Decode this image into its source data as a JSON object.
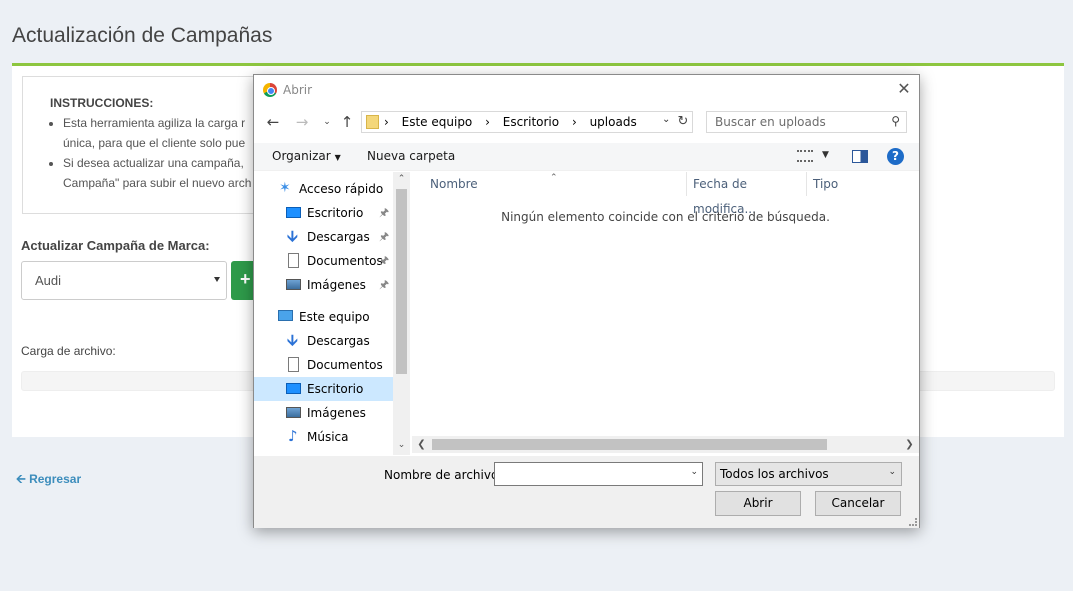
{
  "page": {
    "title": "Actualización de Campañas",
    "instructions": {
      "heading": "INSTRUCCIONES:",
      "items": [
        "Esta herramienta agiliza la carga r",
        "única, para que el cliente solo pue",
        "Si desea actualizar una campaña,",
        "Campaña\" para subir el nuevo arch"
      ]
    },
    "brand_label": "Actualizar Campaña de Marca:",
    "brand_selected": "Audi",
    "add_button": "+",
    "upload_label": "Carga de archivo:",
    "back_link": "Regresar",
    "colors": {
      "accent": "#8dc63f",
      "add_button": "#2e9a4a",
      "link": "#3c8dbc"
    }
  },
  "dialog": {
    "title": "Abrir",
    "close_icon": "close-icon",
    "breadcrumbs": [
      "Este equipo",
      "Escritorio",
      "uploads"
    ],
    "search_placeholder": "Buscar en uploads",
    "toolbar": {
      "organize": "Organizar",
      "new_folder": "Nueva carpeta"
    },
    "nav_items": [
      {
        "label": "Acceso rápido",
        "icon": "star-icon",
        "pinned": false,
        "selected": false
      },
      {
        "label": "Escritorio",
        "icon": "desktop-icon",
        "pinned": true,
        "selected": false
      },
      {
        "label": "Descargas",
        "icon": "download-icon",
        "pinned": true,
        "selected": false
      },
      {
        "label": "Documentos",
        "icon": "document-icon",
        "pinned": true,
        "selected": false
      },
      {
        "label": "Imágenes",
        "icon": "image-icon",
        "pinned": true,
        "selected": false
      },
      {
        "label": "Este equipo",
        "icon": "computer-icon",
        "pinned": false,
        "selected": false
      },
      {
        "label": "Descargas",
        "icon": "download-icon",
        "pinned": false,
        "selected": false
      },
      {
        "label": "Documentos",
        "icon": "document-icon",
        "pinned": false,
        "selected": false
      },
      {
        "label": "Escritorio",
        "icon": "desktop-icon",
        "pinned": false,
        "selected": true
      },
      {
        "label": "Imágenes",
        "icon": "image-icon",
        "pinned": false,
        "selected": false
      },
      {
        "label": "Música",
        "icon": "music-icon",
        "pinned": false,
        "selected": false
      }
    ],
    "columns": [
      "Nombre",
      "Fecha de modifica...",
      "Tipo"
    ],
    "empty_message": "Ningún elemento coincide con el criterio de búsqueda.",
    "filename_label": "Nombre de archivo:",
    "filename_value": "",
    "file_type": "Todos los archivos",
    "open_button": "Abrir",
    "cancel_button": "Cancelar",
    "selected_color": "#cce8ff"
  }
}
